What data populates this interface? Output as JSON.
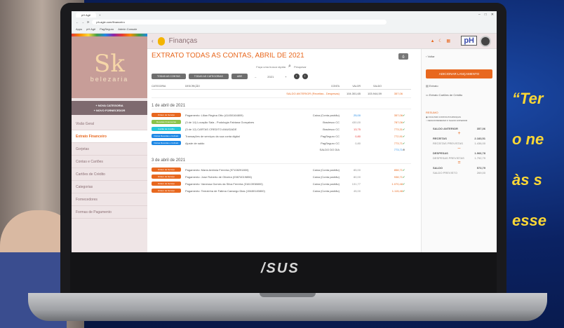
{
  "browser": {
    "tab_title": "pH Agê",
    "url": "ph-agie.com/financeiro",
    "bookmarks": [
      "Apps",
      "pH Agê",
      "PagSeguro",
      "Admin Console"
    ]
  },
  "sidebar": {
    "logo_mark": "Sk",
    "logo_word": "belezaria",
    "add_category": "+ NOVA CATEGORIA",
    "add_supplier": "+ NOVO FORNECEDOR",
    "items": [
      {
        "label": "Visão Geral"
      },
      {
        "label": "Extrato Financeiro"
      },
      {
        "label": "Gorjetas"
      },
      {
        "label": "Contas e Cartões"
      },
      {
        "label": "Cartões de Crédito"
      },
      {
        "label": "Categorias"
      },
      {
        "label": "Fornecedores"
      },
      {
        "label": "Formas de Pagamento"
      }
    ]
  },
  "header": {
    "title": "Finanças",
    "logo_text": "pH"
  },
  "main": {
    "title": "EXTRATO TODAS AS CONTAS, ABRIL DE 2021",
    "search_placeholder": "Faça uma busca rápida",
    "search_label": "Pesquisar",
    "filters": {
      "accounts": "TODAS AS CONTAS",
      "categories": "TODAS AS CATEGORIAS",
      "month": "ABR",
      "year": "2021"
    },
    "columns": [
      "CATEGORIA",
      "DESCRIÇÃO",
      "CONTA",
      "VALOR",
      "SALDO"
    ],
    "previous_balance_label": "SALDO ANTERIOR (Receitas - Despesas)",
    "previous_balance_values": [
      "104.301,65",
      "103.944,59",
      "357,06"
    ],
    "day1": "1 de abril de 2021",
    "rows1": [
      {
        "tag": "Ordem de Serviço",
        "color": "#e8681f",
        "desc": "Pagamento: Lilian Regina Otto (41450164809)",
        "account": "Caixa (Conta padrão)",
        "value": "25,00",
        "balance": "357,06",
        "vclass": "blue"
      },
      {
        "tag": "Receitas Financeiras",
        "color": "#8bc34a",
        "desc": "(3 de 14) Locação Sala - Podologia Fabiana Gonçalves",
        "account": "Bradesco CC",
        "value": "430,00",
        "balance": "787,06",
        "vclass": "gray"
      },
      {
        "tag": "Cartão de Crédito",
        "color": "#26c6da",
        "desc": "(3 de 12) CARTAS CREDITO ANUIDADE",
        "account": "Bradesco CC",
        "value": "13,75",
        "balance": "773,31",
        "vclass": "red"
      },
      {
        "tag": "Outras Receitas e Cobrad.",
        "color": "#1e88e5",
        "desc": "Transações de serviços da sua conta digital",
        "account": "PagSeguro CC",
        "value": "0,80",
        "balance": "772,91",
        "vclass": "red"
      },
      {
        "tag": "Outras Receitas e Cobrad.",
        "color": "#1e88e5",
        "desc": "Ajuste de saldo",
        "account": "PagSeguro CC",
        "value": "0,80",
        "balance": "773,71",
        "vclass": "gray"
      }
    ],
    "day_balance_label": "SALDO DO DIA",
    "day_balance_value": "773,71",
    "day2": "3 de abril de 2021",
    "rows2": [
      {
        "tag": "Ordem de Serviço",
        "color": "#e8681f",
        "desc": "Pagamento: Maria Antônia Ferreira (97108291800)",
        "account": "Caixa (Conta padrão)",
        "value": "85,00",
        "balance": "858,71",
        "vclass": "gray"
      },
      {
        "tag": "Ordem de Serviço",
        "color": "#e8681f",
        "desc": "Pagamento: Jose Roberto de Oliveira (03874019896)",
        "account": "Caixa (Conta padrão)",
        "value": "80,00",
        "balance": "938,71",
        "vclass": "gray"
      },
      {
        "tag": "Ordem de Serviço",
        "color": "#e8681f",
        "desc": "Pagamento: Vanessa Gomes da Silva Ferreira (31613938800)",
        "account": "Caixa (Conta padrão)",
        "value": "131,77",
        "balance": "1.070,48",
        "vclass": "gray"
      },
      {
        "tag": "Ordem de Serviço",
        "color": "#e8681f",
        "desc": "Pagamento: Terezinha de Fatima Camargo Dias (15480145800)",
        "account": "Caixa (Conta padrão)",
        "value": "45,00",
        "balance": "1.115,48",
        "vclass": "gray"
      }
    ]
  },
  "right_panel": {
    "back": "Voltar",
    "add_button": "ADICIONAR LANÇAMENTO",
    "link_extrato": "Extrato",
    "link_cards": "Extrato Cartões de Crédito",
    "summary_title": "RESUMO",
    "toggle1": "OCULTAR CONTAS POUPANÇAS",
    "toggle2": "DESCONSIDERAR O SALDO ANTERIOR",
    "saldo_anterior_label": "SALDO ANTERIOR",
    "saldo_anterior_value": "357,06",
    "receitas_label": "RECEITAS",
    "receitas_value": "2.183,51",
    "receitas_prev_label": "RECEITAS PREVISTAS",
    "receitas_prev_value": "1.436,00",
    "despesas_label": "DESPESAS",
    "despesas_value": "1.966,78",
    "despesas_prev_label": "DESPESAS PREVISTAS",
    "despesas_prev_value": "1.792,79",
    "saldo_label": "SALDO",
    "saldo_value": "573,79",
    "saldo_prev_label": "SALDO PREVISTO",
    "saldo_prev_value": "269,00"
  },
  "laptop_brand": "/SUS",
  "quote_lines": [
    "“Ter",
    "o ne",
    "às s",
    "esse"
  ]
}
